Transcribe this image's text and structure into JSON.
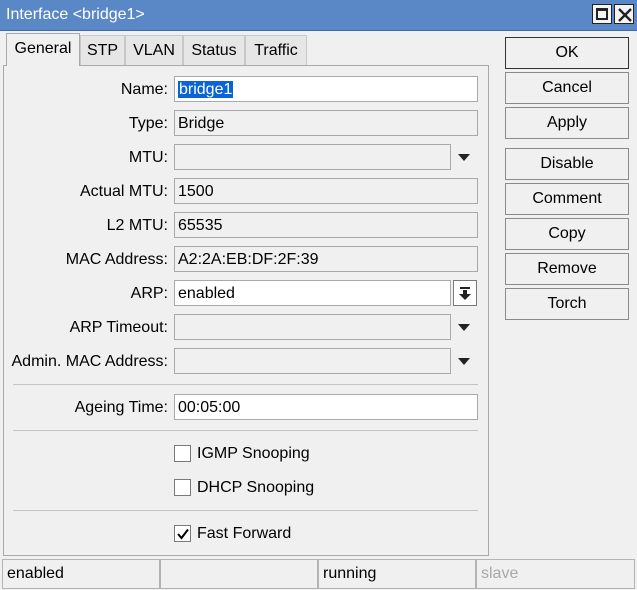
{
  "window": {
    "title": "Interface <bridge1>"
  },
  "tabs": [
    {
      "label": "General",
      "active": true
    },
    {
      "label": "STP"
    },
    {
      "label": "VLAN"
    },
    {
      "label": "Status"
    },
    {
      "label": "Traffic"
    }
  ],
  "fields": {
    "name": {
      "label": "Name:",
      "value": "bridge1"
    },
    "type": {
      "label": "Type:",
      "value": "Bridge"
    },
    "mtu": {
      "label": "MTU:",
      "value": ""
    },
    "actual_mtu": {
      "label": "Actual MTU:",
      "value": "1500"
    },
    "l2_mtu": {
      "label": "L2 MTU:",
      "value": "65535"
    },
    "mac_address": {
      "label": "MAC Address:",
      "value": "A2:2A:EB:DF:2F:39"
    },
    "arp": {
      "label": "ARP:",
      "value": "enabled"
    },
    "arp_timeout": {
      "label": "ARP Timeout:",
      "value": ""
    },
    "admin_mac": {
      "label": "Admin. MAC Address:",
      "value": ""
    },
    "ageing_time": {
      "label": "Ageing Time:",
      "value": "00:05:00"
    }
  },
  "checkboxes": {
    "igmp": {
      "label": "IGMP Snooping",
      "checked": false
    },
    "dhcp": {
      "label": "DHCP Snooping",
      "checked": false
    },
    "fast_forward": {
      "label": "Fast Forward",
      "checked": true
    }
  },
  "buttons": {
    "ok": "OK",
    "cancel": "Cancel",
    "apply": "Apply",
    "disable": "Disable",
    "comment": "Comment",
    "copy": "Copy",
    "remove": "Remove",
    "torch": "Torch"
  },
  "status": {
    "state": "enabled",
    "middle": "",
    "running": "running",
    "slave": "slave"
  }
}
